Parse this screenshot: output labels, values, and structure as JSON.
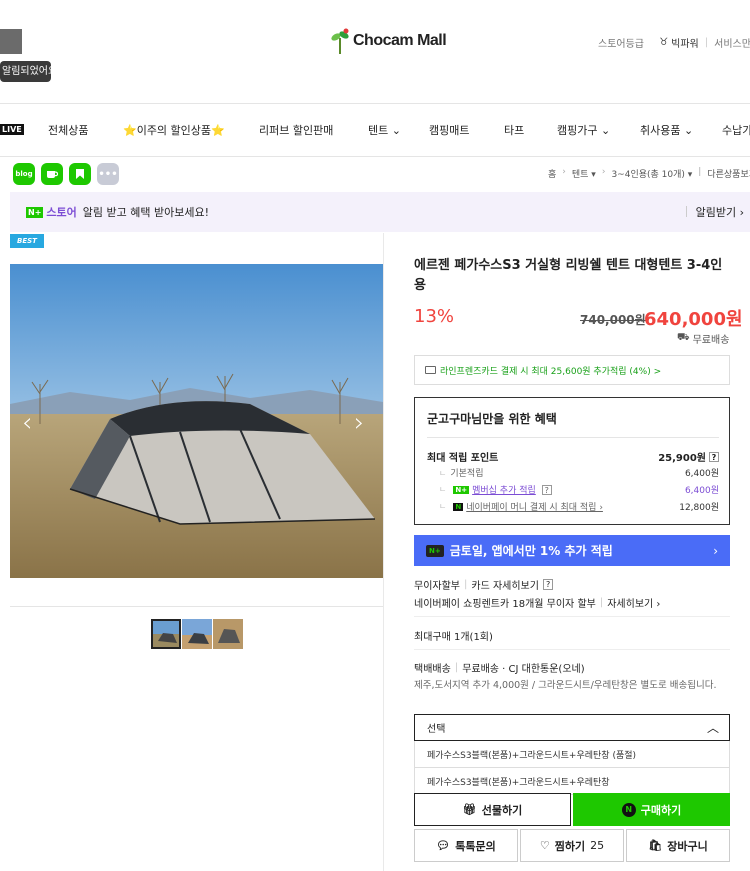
{
  "toast": {
    "text": "알림되었어요!"
  },
  "header": {
    "logo_text": "Chocam Mall",
    "links": [
      "스토어등급",
      "빅파워",
      "서비스만족"
    ]
  },
  "nav": {
    "live_label": "LIVE",
    "items": [
      "전체상품",
      "⭐이주의 할인상품⭐",
      "리퍼브 할인판매",
      "텐트 ⌄",
      "캠핑매트",
      "타프",
      "캠핑가구 ⌄",
      "취사용품 ⌄",
      "수납가"
    ]
  },
  "share": {
    "icons": [
      "blog",
      "cafe",
      "bookmark",
      "more"
    ],
    "blog_label": "blog"
  },
  "breadcrumb": [
    "홈",
    "텐트 ▾",
    "3~4인용(총 10개) ▾",
    "다른상품보기"
  ],
  "banner": {
    "store_label": "스토어",
    "message": "알림 받고 혜택 받아보세요!",
    "notify_button": "알림받기 ›"
  },
  "badge": {
    "best": "BEST"
  },
  "product": {
    "title": "에르젠 페가수스S3 거실형 리빙쉘 텐트 대형텐트 3-4인용",
    "discount": "13%",
    "original_price": "740,000원",
    "price": "640,000원",
    "shipping_badge": "무료배송",
    "card_benefit": "라인프렌즈카드 결제 시 최대 25,600원 추가적립 (4%) >"
  },
  "benefit": {
    "title": "군고구마님만을 위한 혜택",
    "max_label": "최대 적립 포인트",
    "max_value": "25,900원",
    "basic_label": "기본적립",
    "basic_value": "6,400원",
    "member_label": "멤버십 추가 적립",
    "member_value": "6,400원",
    "npay_label": "네이버페이 머니 결제 시 최대 적립 ›",
    "npay_value": "12,800원"
  },
  "promo": {
    "text": "금토일, 앱에서만 1% 추가 적립",
    "chevron": "›"
  },
  "info": {
    "installment_label": "무이자할부",
    "installment_link": "카드 자세히보기",
    "rental_text": "네이버페이 쇼핑렌트카 18개월 무이자 할부",
    "rental_link": "자세히보기 ›",
    "max_purchase": "최대구매 1개(1회)",
    "delivery_label": "택배배송",
    "delivery_value": "무료배송 · CJ 대한통운(오네)",
    "delivery_note": "제주,도서지역 추가 4,000원 / 그라운드시트/우레탄창은 별도로 배송됩니다."
  },
  "select": {
    "label": "선택",
    "options": [
      "페가수스S3블랙(본품)+그라운드시트+우레탄창 (품절)",
      "페가수스S3블랙(본품)+그라운드시트+우레탄창"
    ]
  },
  "buttons": {
    "gift": "선물하기",
    "buy": "구매하기",
    "talk": "톡톡문의",
    "zzim": "찜하기",
    "zzim_count": "25",
    "cart": "장바구니"
  },
  "colors": {
    "brand_green": "#1ec800",
    "price_red": "#f0443e",
    "promo_blue": "#4a6cf7",
    "best_blue": "#28a8e0"
  }
}
